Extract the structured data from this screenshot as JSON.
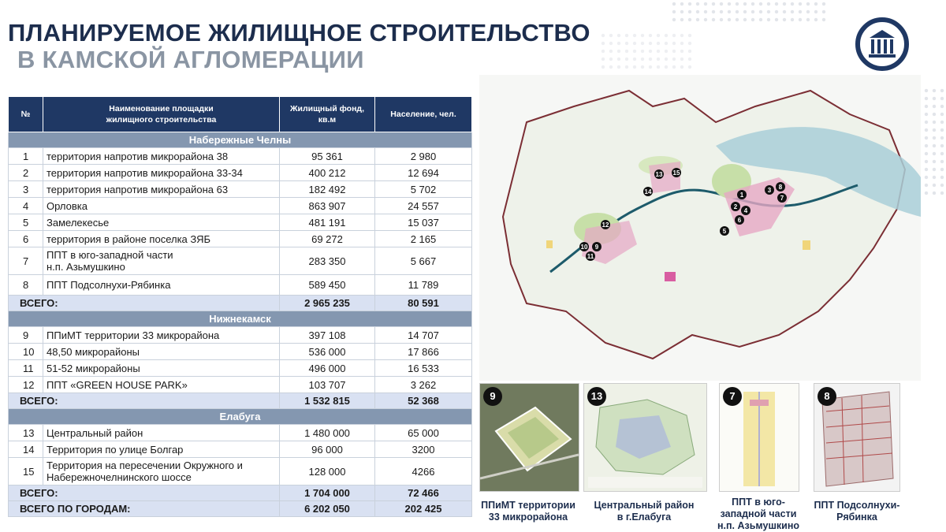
{
  "title": {
    "line1": "ПЛАНИРУЕМОЕ ЖИЛИЩНОЕ СТРОИТЕЛЬСТВО",
    "line2": "В КАМСКОЙ АГЛОМЕРАЦИИ"
  },
  "colors": {
    "header_bg": "#1f3864",
    "city_row_bg": "#8497b0",
    "total_row_bg": "#d9e1f2",
    "title_dark": "#1c2d4d",
    "title_grey": "#8a95a3"
  },
  "logo": {
    "icon": "columns-building-icon"
  },
  "table": {
    "headers": {
      "num": "№",
      "name_line1": "Наименование площадки",
      "name_line2": "жилищного строительства",
      "fund_line1": "Жилищный фонд,",
      "fund_line2": "кв.м",
      "population": "Население, чел."
    },
    "groups": [
      {
        "city": "Набережные Челны",
        "rows": [
          {
            "num": "1",
            "name": "территория напротив микрорайона 38",
            "fund": "95 361",
            "pop": "2 980"
          },
          {
            "num": "2",
            "name": "территория напротив микрорайона 33-34",
            "fund": "400 212",
            "pop": "12 694"
          },
          {
            "num": "3",
            "name": "территория напротив микрорайона 63",
            "fund": "182 492",
            "pop": "5 702"
          },
          {
            "num": "4",
            "name": "Орловка",
            "fund": "863 907",
            "pop": "24 557"
          },
          {
            "num": "5",
            "name": "Замелекесье",
            "fund": "481 191",
            "pop": "15 037"
          },
          {
            "num": "6",
            "name": "территория в районе поселка ЗЯБ",
            "fund": "69 272",
            "pop": "2 165"
          },
          {
            "num": "7",
            "name": "ППТ в юго-западной части",
            "name2": "н.п. Азьмушкино",
            "fund": "283 350",
            "pop": "5 667"
          },
          {
            "num": "8",
            "name": "ППТ Подсолнухи-Рябинка",
            "fund": "589 450",
            "pop": "11 789"
          }
        ],
        "total": {
          "label": "ВСЕГО:",
          "fund": "2 965 235",
          "pop": "80 591"
        }
      },
      {
        "city": "Нижнекамск",
        "rows": [
          {
            "num": "9",
            "name": "ППиМТ территории 33 микрорайона",
            "fund": "397 108",
            "pop": "14 707"
          },
          {
            "num": "10",
            "name": "48,50 микрорайоны",
            "fund": "536 000",
            "pop": "17 866"
          },
          {
            "num": "11",
            "name": "51-52 микрорайоны",
            "fund": "496 000",
            "pop": "16 533"
          },
          {
            "num": "12",
            "name": "ППТ «GREEN HOUSE PARK»",
            "fund": "103 707",
            "pop": "3 262"
          }
        ],
        "total": {
          "label": "ВСЕГО:",
          "fund": "1 532 815",
          "pop": "52 368"
        }
      },
      {
        "city": "Елабуга",
        "rows": [
          {
            "num": "13",
            "name": "Центральный район",
            "fund": "1 480 000",
            "pop": "65 000"
          },
          {
            "num": "14",
            "name": "Территория по улице Болгар",
            "fund": "96 000",
            "pop": "3200"
          },
          {
            "num": "15",
            "name": "Территория на пересечении Окружного и",
            "name2": "Набережночелнинского шоссе",
            "fund": "128 000",
            "pop": "4266"
          }
        ],
        "total": {
          "label": "ВСЕГО:",
          "fund": "1 704 000",
          "pop": "72 466"
        }
      }
    ],
    "grand_total": {
      "label": "ВСЕГО ПО ГОРОДАМ:",
      "fund": "6 202 050",
      "pop": "202 425"
    }
  },
  "map": {
    "markers": [
      "1",
      "2",
      "3",
      "4",
      "5",
      "6",
      "7",
      "8",
      "9",
      "10",
      "11",
      "12",
      "13",
      "14",
      "15"
    ]
  },
  "thumbnails": [
    {
      "badge": "9",
      "caption_line1": "ППиМТ территории",
      "caption_line2": "33 микрорайона"
    },
    {
      "badge": "13",
      "caption_line1": "Центральный район",
      "caption_line2": "в г.Елабуга"
    },
    {
      "badge": "7",
      "caption_line1": "ППТ в юго-",
      "caption_line2": "западной части",
      "caption_line3": "н.п. Азьмушкино"
    },
    {
      "badge": "8",
      "caption_line1": "ППТ Подсолнухи-",
      "caption_line2": "Рябинка"
    }
  ]
}
